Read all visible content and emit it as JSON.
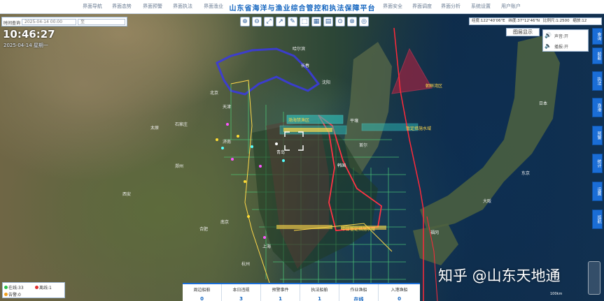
{
  "nav": {
    "left": [
      "界面导航",
      "界面态势",
      "界面预警",
      "界面执法",
      "界面渔业"
    ],
    "title": "山东省海洋与渔业综合管控和执法保障平台",
    "right": [
      "界面安全",
      "界面调度",
      "界面分析",
      "系统设置",
      "用户账户"
    ]
  },
  "time_panel": {
    "label": "时间查询",
    "start": "2025-04-14 00:00",
    "end": "至"
  },
  "clock": "10:46:27",
  "date": "2025-04-14 星期一",
  "toolbar": [
    "⊕",
    "⊖",
    "⤢",
    "↗",
    "✎",
    "⬚",
    "▦",
    "▤",
    "⊙",
    "⊗",
    "◎"
  ],
  "coord_bar": {
    "a": "经度:122°40'06\"E",
    "b": "纬度:37°12'46\"N",
    "c": "比例尺:1:2500",
    "d": "缩放:12"
  },
  "layer_btn": "图层显示",
  "audio": {
    "r1": "声音:开",
    "r2": "播报:开"
  },
  "right_bar": [
    "查询",
    "船舶",
    "执法",
    "渔港",
    "预警",
    "统计",
    "设置",
    "巡航"
  ],
  "legend": {
    "r1": "在线:33",
    "r2": "离线:1",
    "r3": "告警:0"
  },
  "stats": [
    {
      "t": "周边船舶",
      "v": "0"
    },
    {
      "t": "本日违规",
      "v": "3"
    },
    {
      "t": "预警事件",
      "v": "1"
    },
    {
      "t": "执法船舶",
      "v": "1"
    },
    {
      "t": "作业渔船",
      "v": "在线"
    },
    {
      "t": "入港渔船",
      "v": "0"
    }
  ],
  "labels": {
    "korea": "韩国",
    "zone1": "朝鲜湾区",
    "zone2": "暂定措施水域",
    "zone3": "渤海禁渔区",
    "zone4": "中日暂定措施水域",
    "japan": "日本"
  },
  "places": [
    "哈尔滨",
    "长春",
    "沈阳",
    "北京",
    "天津",
    "济南",
    "青岛",
    "郑州",
    "南京",
    "上海",
    "合肥",
    "杭州",
    "首尔",
    "平壤",
    "福冈",
    "大阪",
    "东京",
    "西安",
    "太原",
    "石家庄"
  ],
  "watermark": "知乎 @山东天地通",
  "scale": "100km"
}
